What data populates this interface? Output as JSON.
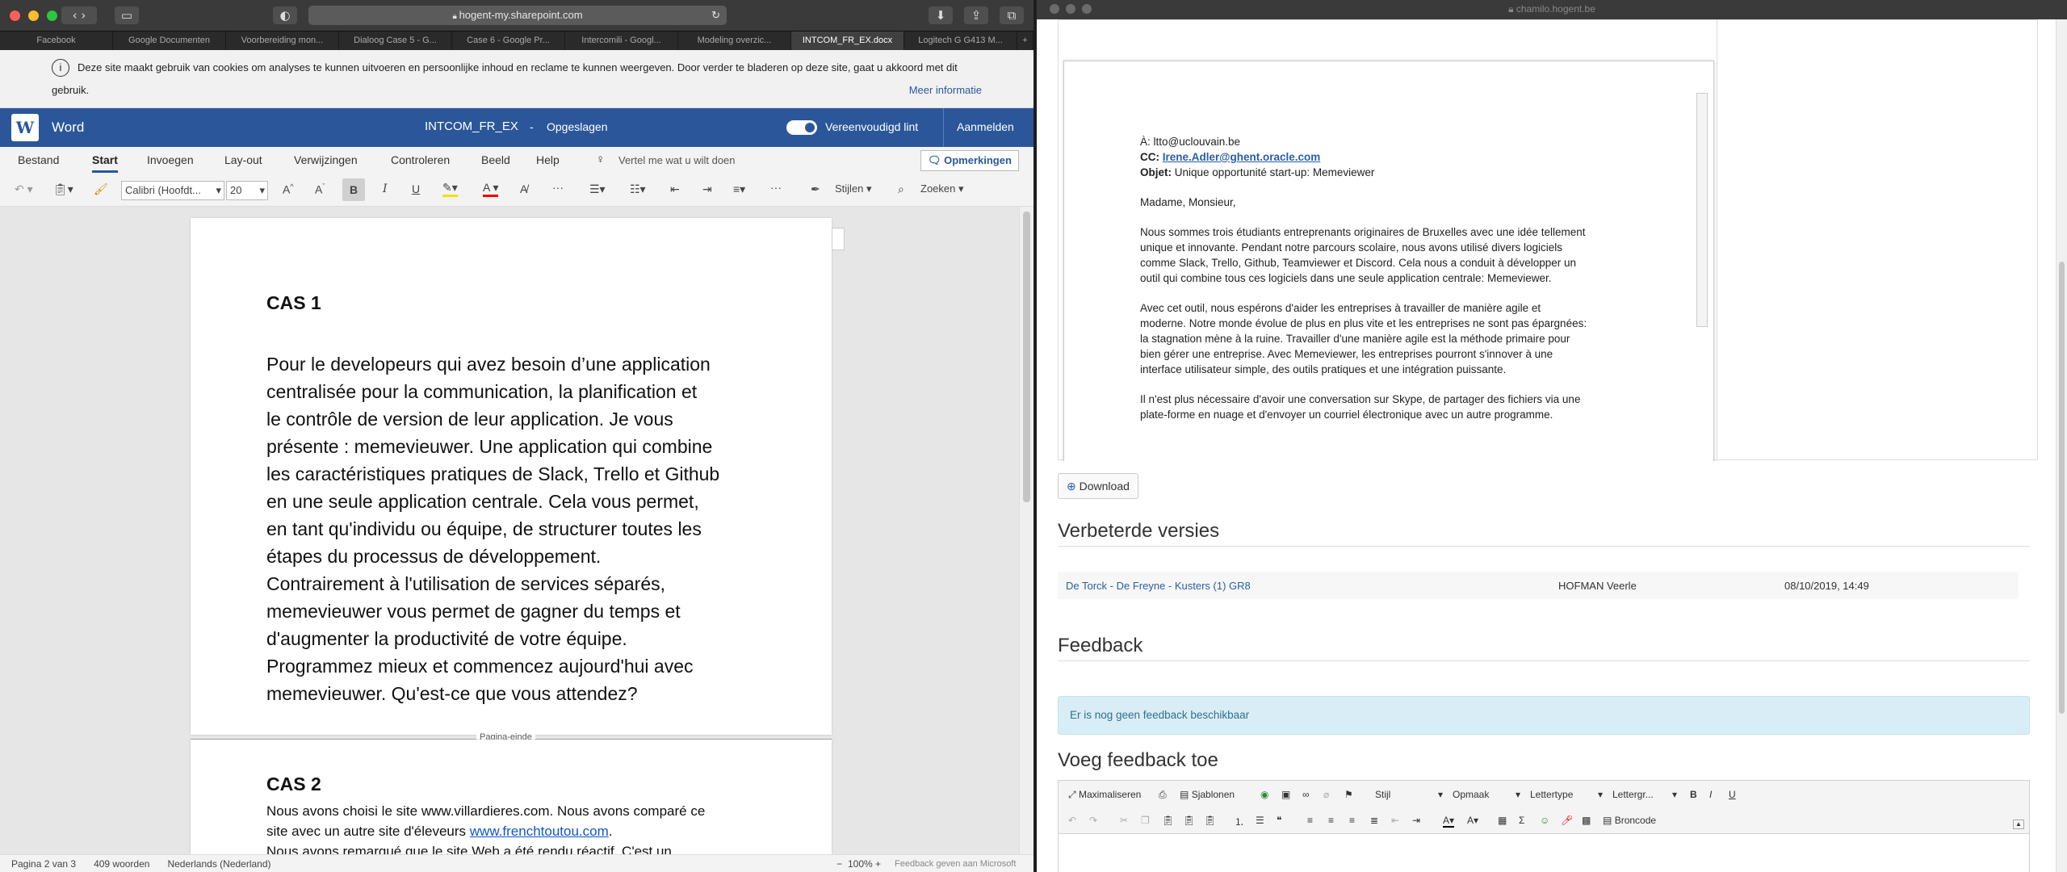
{
  "left": {
    "url": "hogent-my.sharepoint.com",
    "tabs": [
      "Facebook",
      "Google Documenten",
      "Voorbereiding mon...",
      "Dialoog Case 5 - G...",
      "Case 6 - Google Pr...",
      "Intercomili - Googl...",
      "Modeling overzic...",
      "INTCOM_FR_EX.docx",
      "Logitech G G413 M..."
    ],
    "cookie_text_1": "Deze site maakt gebruik van cookies om analyses te kunnen uitvoeren en persoonlijke inhoud en reclame te kunnen weergeven. Door verder te bladeren op deze site, gaat u akkoord met dit",
    "cookie_text_2": "gebruik.",
    "cookie_more": "Meer informatie",
    "app_name": "Word",
    "doc_title": "INTCOM_FR_EX",
    "doc_sep": "-",
    "doc_status": "Opgeslagen",
    "simplified_ribbon": "Vereenvoudigd lint",
    "signin": "Aanmelden",
    "menu": [
      "Bestand",
      "Start",
      "Invoegen",
      "Lay-out",
      "Verwijzingen",
      "Controleren",
      "Beeld",
      "Help"
    ],
    "tell_me": "Vertel me wat u wilt doen",
    "comments": "Opmerkingen",
    "font_name": "Calibri (Hoofdt...",
    "font_size": "20",
    "styles": "Stijlen",
    "find": "Zoeken",
    "cas1_title": "CAS 1",
    "cas1_lines": [
      "Pour le developeurs qui avez besoin d’une application",
      "centralisée pour la communication, la planification et",
      "le contrôle de version de leur application. Je vous",
      "présente : memevieuwer. Une application qui combine",
      "les caractéristiques pratiques de Slack, Trello et Github",
      "en une seule application centrale. Cela vous permet,",
      "en tant qu'individu ou équipe, de structurer toutes les",
      "étapes du processus de développement.",
      "Contrairement à l'utilisation de services séparés,",
      "memevieuwer vous permet de gagner du temps et",
      "d'augmenter la productivité de votre équipe.",
      "Programmez mieux et commencez aujourd'hui avec",
      "memevieuwer. Qu'est-ce que vous attendez?"
    ],
    "page_break": "Pagina-einde",
    "cas2_title": "CAS 2",
    "cas2_line1": "Nous avons choisi le site www.villardieres.com. Nous avons comparé ce",
    "cas2_line2_pre": "site avec un autre site d'éleveurs ",
    "cas2_link": "www.frenchtoutou.com",
    "cas2_line2_post": ".",
    "cas2_line3": "Nous avons remarqué que le site Web a été rendu réactif. C'est un",
    "status_page": "Pagina 2 van 3",
    "status_words": "409 woorden",
    "status_lang": "Nederlands (Nederland)",
    "zoom": "100%",
    "feedback": "Feedback geven aan Microsoft"
  },
  "right": {
    "url": "chamilo.hogent.be",
    "email": {
      "to_label": "À:",
      "to": "ltto@uclouvain.be",
      "cc_label": "CC:",
      "cc": "Irene.Adler@ghent.oracle.com",
      "subject_label": "Objet:",
      "subject": "Unique opportunité start-up: Memeviewer",
      "greeting": "Madame, Monsieur,",
      "p1": [
        "Nous sommes trois étudiants entreprenants originaires de Bruxelles avec une idée tellement",
        "unique et innovante. Pendant notre parcours scolaire, nous avons utilisé divers logiciels",
        "comme Slack, Trello, Github, Teamviewer et Discord. Cela nous a conduit à développer un",
        "outil qui combine tous ces logiciels dans une seule application centrale: Memeviewer."
      ],
      "p2": [
        "Avec cet outil, nous espérons d'aider les entreprises à travailler de manière agile et",
        "moderne. Notre monde évolue de plus en plus vite et les entreprises ne sont pas épargnées:",
        "la stagnation mène à la ruine. Travailler d'une manière agile est la méthode primaire pour",
        "bien gérer une entreprise. Avec Memeviewer, les entreprises pourront s'innover à une",
        "interface utilisateur simple, des outils pratiques et une intégration puissante."
      ],
      "p3": [
        "Il n'est plus nécessaire d'avoir une conversation sur Skype, de partager des fichiers via une",
        "plate-forme en nuage et d'envoyer un courriel électronique avec un autre programme."
      ]
    },
    "download": "Download",
    "improved_title": "Verbeterde versies",
    "improved_row": {
      "name": "De Torck - De Freyne - Kusters (1) GR8",
      "author": "HOFMAN Veerle",
      "date": "08/10/2019, 14:49"
    },
    "feedback_title": "Feedback",
    "feedback_empty": "Er is nog geen feedback beschikbaar",
    "add_feedback_title": "Voeg feedback toe",
    "editor": {
      "maximize": "Maximaliseren",
      "templates": "Sjablonen",
      "style": "Stijl",
      "format": "Opmaak",
      "font": "Lettertype",
      "size": "Lettergr...",
      "source": "Broncode"
    }
  },
  "colors": {
    "word_blue": "#2b579a",
    "info_bg": "#d9edf7",
    "link": "#2a5da8"
  }
}
